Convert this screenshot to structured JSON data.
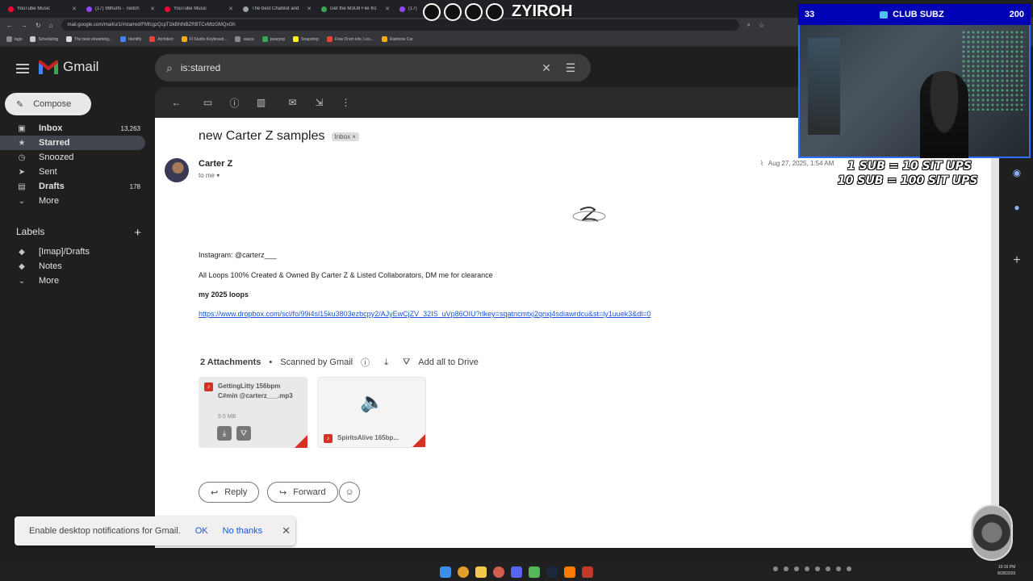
{
  "browser": {
    "tabs": [
      {
        "title": "YouTube Music",
        "color": "#ff0033"
      },
      {
        "title": "(17) 98hurts - Twitch",
        "color": "#9146ff"
      },
      {
        "title": "YouTube Music",
        "color": "#ff0033"
      },
      {
        "title": "The best ChatBot and",
        "color": "#9aa0a6"
      },
      {
        "title": "Get the M3U8 File fro",
        "color": "#34a853"
      },
      {
        "title": "(17)",
        "color": "#9146ff"
      }
    ],
    "url": "mail.google.com/mail/u/1/#starred/FMfcgzQcpTlzkBNNBZRBTCvMtzGMQxGh",
    "bookmarks": [
      "tags",
      "Scheduling",
      "The best streaming...",
      "Identify",
      "Architect",
      "Fl Studio Keyboard...",
      "sauce",
      "pearpop",
      "Snapdrop",
      "Free Drum kits, Loo...",
      "Rainbow Car"
    ]
  },
  "gmail": {
    "app_name": "Gmail",
    "compose_label": "Compose",
    "search_query": "is:starred",
    "nav": [
      {
        "label": "Inbox",
        "count": "13,263",
        "icon": "inbox-icon",
        "bold": true
      },
      {
        "label": "Starred",
        "count": "",
        "icon": "star-icon",
        "bold": false,
        "active": true
      },
      {
        "label": "Snoozed",
        "count": "",
        "icon": "clock-icon"
      },
      {
        "label": "Sent",
        "count": "",
        "icon": "send-icon"
      },
      {
        "label": "Drafts",
        "count": "178",
        "icon": "draft-icon",
        "bold": true
      },
      {
        "label": "More",
        "count": "",
        "icon": "chevron-down-icon"
      }
    ],
    "labels_heading": "Labels",
    "labels": [
      {
        "label": "[Imap]/Drafts",
        "icon": "label-icon"
      },
      {
        "label": "Notes",
        "icon": "label-icon"
      },
      {
        "label": "More",
        "icon": "chevron-down-icon"
      }
    ]
  },
  "email": {
    "subject": "new Carter Z samples",
    "chip": "Inbox",
    "sender": "Carter Z",
    "to": "to me",
    "date": "Aug 27, 2025, 1:54 AM",
    "instagram": "Instagram: @carterz___",
    "disclaimer": "All Loops 100% Created & Owned By Carter Z & Listed Collaborators, DM me for clearance",
    "heading": "my 2025 loops",
    "link": "https://www.dropbox.com/scl/fo/99i4sl15ku3803ezbcpy2/AJyEwCjZV_32IS_uVp86OIU?rlkey=sqatncmtxj2qnxj4sdiawrdcu&st=ly1uuek3&dl=0",
    "attachments_title": "2 Attachments",
    "scanned": "Scanned by Gmail",
    "add_all": "Add all to Drive",
    "attachments": [
      {
        "name": "GettingLitty 156bpm C#min @carterz___.mp3",
        "size": "5.5 MB"
      },
      {
        "name": "SpiritsAlive 165bp..."
      }
    ],
    "reply": "Reply",
    "forward": "Forward"
  },
  "toast": {
    "text": "Enable desktop notifications for Gmail.",
    "ok": "OK",
    "no_thanks": "No thanks"
  },
  "stream": {
    "sub_count": "33",
    "club_label": "CLUB SUBZ",
    "goal": "200",
    "situp_1": "1 SUB = 10 SIT UPS",
    "situp_2": "10 SUB = 100 SIT UPS",
    "channel": "ZYIROH"
  },
  "system": {
    "time": "10:16 PM",
    "date": "8/28/2025"
  },
  "colors": {
    "accent_blue": "#1a55d6",
    "gmail_red": "#d93025",
    "sub_bar": "#0000b4"
  }
}
